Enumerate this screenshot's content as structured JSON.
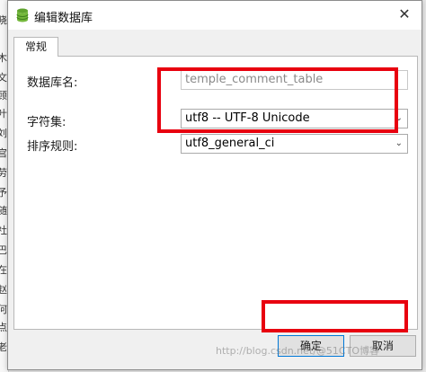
{
  "dialog": {
    "title": "编辑数据库",
    "close_label": "✕"
  },
  "tabs": [
    {
      "label": "常规"
    }
  ],
  "form": {
    "db_name_label": "数据库名:",
    "db_name_value": "temple_comment_table",
    "charset_label": "字符集:",
    "charset_value": "utf8 -- UTF-8 Unicode",
    "collation_label": "排序规则:",
    "collation_value": "utf8_general_ci"
  },
  "buttons": {
    "ok": "确定",
    "cancel": "取消"
  },
  "watermark": "http://blog.csdn.net/@51CTO博客",
  "background_chars": [
    "晓",
    "木",
    "文",
    "顾",
    "叶",
    "刘",
    "宫",
    "劳",
    "予",
    "随",
    "社",
    "巴",
    "在",
    "赵",
    "何",
    "点",
    "老"
  ],
  "colors": {
    "highlight": "#e8000f",
    "ok_border": "#0078d7"
  }
}
